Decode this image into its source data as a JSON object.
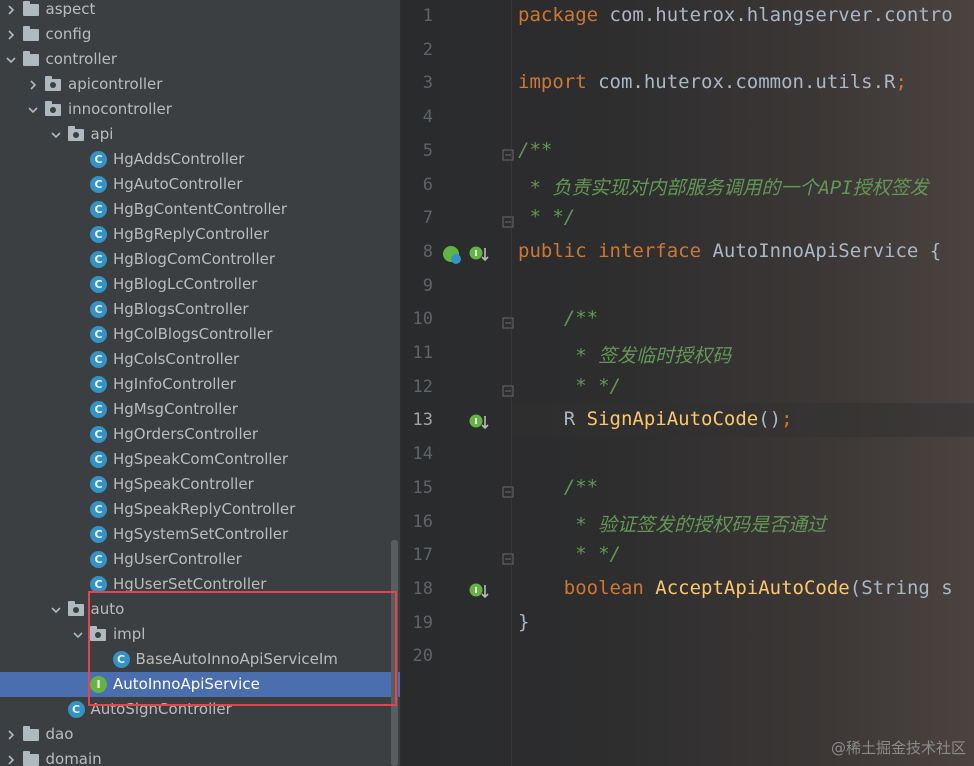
{
  "tree": {
    "items": [
      {
        "label": "aspect",
        "type": "folder",
        "depth": 3,
        "expanded": false,
        "selected": false
      },
      {
        "label": "config",
        "type": "folder",
        "depth": 3,
        "expanded": false,
        "selected": false
      },
      {
        "label": "controller",
        "type": "folder",
        "depth": 3,
        "expanded": true,
        "selected": false
      },
      {
        "label": "apicontroller",
        "type": "folder",
        "depth": 4,
        "expanded": false,
        "selected": false
      },
      {
        "label": "innocontroller",
        "type": "folder",
        "depth": 4,
        "expanded": true,
        "selected": false
      },
      {
        "label": "api",
        "type": "folder",
        "depth": 5,
        "expanded": true,
        "selected": false
      },
      {
        "label": "HgAddsController",
        "type": "class",
        "depth": 6,
        "selected": false
      },
      {
        "label": "HgAutoController",
        "type": "class",
        "depth": 6,
        "selected": false
      },
      {
        "label": "HgBgContentController",
        "type": "class",
        "depth": 6,
        "selected": false
      },
      {
        "label": "HgBgReplyController",
        "type": "class",
        "depth": 6,
        "selected": false
      },
      {
        "label": "HgBlogComController",
        "type": "class",
        "depth": 6,
        "selected": false
      },
      {
        "label": "HgBlogLcController",
        "type": "class",
        "depth": 6,
        "selected": false
      },
      {
        "label": "HgBlogsController",
        "type": "class",
        "depth": 6,
        "selected": false
      },
      {
        "label": "HgColBlogsController",
        "type": "class",
        "depth": 6,
        "selected": false
      },
      {
        "label": "HgColsController",
        "type": "class",
        "depth": 6,
        "selected": false
      },
      {
        "label": "HgInfoController",
        "type": "class",
        "depth": 6,
        "selected": false
      },
      {
        "label": "HgMsgController",
        "type": "class",
        "depth": 6,
        "selected": false
      },
      {
        "label": "HgOrdersController",
        "type": "class",
        "depth": 6,
        "selected": false
      },
      {
        "label": "HgSpeakComController",
        "type": "class",
        "depth": 6,
        "selected": false
      },
      {
        "label": "HgSpeakController",
        "type": "class",
        "depth": 6,
        "selected": false
      },
      {
        "label": "HgSpeakReplyController",
        "type": "class",
        "depth": 6,
        "selected": false
      },
      {
        "label": "HgSystemSetController",
        "type": "class",
        "depth": 6,
        "selected": false
      },
      {
        "label": "HgUserController",
        "type": "class",
        "depth": 6,
        "selected": false
      },
      {
        "label": "HgUserSetController",
        "type": "class",
        "depth": 6,
        "selected": false
      },
      {
        "label": "auto",
        "type": "folder",
        "depth": 5,
        "expanded": true,
        "selected": false
      },
      {
        "label": "impl",
        "type": "folder",
        "depth": 6,
        "expanded": true,
        "selected": false
      },
      {
        "label": "BaseAutoInnoApiServiceIm",
        "type": "class",
        "depth": 7,
        "selected": false
      },
      {
        "label": "AutoInnoApiService",
        "type": "interface",
        "depth": 6,
        "selected": true
      },
      {
        "label": "AutoSignController",
        "type": "class",
        "depth": 5,
        "selected": false
      },
      {
        "label": "dao",
        "type": "folder",
        "depth": 3,
        "expanded": false,
        "selected": false
      },
      {
        "label": "domain",
        "type": "folder",
        "depth": 3,
        "expanded": false,
        "selected": false
      }
    ]
  },
  "editor": {
    "current_line": 13,
    "lines": [
      {
        "n": "1",
        "tokens": [
          {
            "t": "package ",
            "c": "kw"
          },
          {
            "t": "com.huterox.hlangserver.contro",
            "c": "tx"
          }
        ]
      },
      {
        "n": "2",
        "tokens": []
      },
      {
        "n": "3",
        "tokens": [
          {
            "t": "import ",
            "c": "kw"
          },
          {
            "t": "com.huterox.common.utils.R",
            "c": "tx"
          },
          {
            "t": ";",
            "c": "kw"
          }
        ]
      },
      {
        "n": "4",
        "tokens": []
      },
      {
        "n": "5",
        "tokens": [
          {
            "t": "/**",
            "c": "cm"
          }
        ]
      },
      {
        "n": "6",
        "tokens": [
          {
            "t": " * 负责实现对内部服务调用的一个API授权签发",
            "c": "cm"
          }
        ]
      },
      {
        "n": "7",
        "tokens": [
          {
            "t": " * */",
            "c": "cm"
          }
        ]
      },
      {
        "n": "8",
        "tokens": [
          {
            "t": "public interface ",
            "c": "kw"
          },
          {
            "t": "AutoInnoApiService {",
            "c": "tx"
          }
        ]
      },
      {
        "n": "9",
        "tokens": []
      },
      {
        "n": "10",
        "tokens": [
          {
            "t": "    /**",
            "c": "cm"
          }
        ]
      },
      {
        "n": "11",
        "tokens": [
          {
            "t": "     * 签发临时授权码",
            "c": "cm"
          }
        ]
      },
      {
        "n": "12",
        "tokens": [
          {
            "t": "     * */",
            "c": "cm"
          }
        ]
      },
      {
        "n": "13",
        "tokens": [
          {
            "t": "    R ",
            "c": "tx"
          },
          {
            "t": "SignApiAutoCode",
            "c": "fn"
          },
          {
            "t": "()",
            "c": "tx"
          },
          {
            "t": ";",
            "c": "kw"
          }
        ]
      },
      {
        "n": "14",
        "tokens": []
      },
      {
        "n": "15",
        "tokens": [
          {
            "t": "    /**",
            "c": "cm"
          }
        ]
      },
      {
        "n": "16",
        "tokens": [
          {
            "t": "     * 验证签发的授权码是否通过",
            "c": "cm"
          }
        ]
      },
      {
        "n": "17",
        "tokens": [
          {
            "t": "     * */",
            "c": "cm"
          }
        ]
      },
      {
        "n": "18",
        "tokens": [
          {
            "t": "    ",
            "c": "tx"
          },
          {
            "t": "boolean ",
            "c": "kw"
          },
          {
            "t": "AcceptApiAutoCode",
            "c": "fn"
          },
          {
            "t": "(String s",
            "c": "tx"
          }
        ]
      },
      {
        "n": "19",
        "tokens": [
          {
            "t": "}",
            "c": "tx"
          }
        ]
      },
      {
        "n": "20",
        "tokens": []
      }
    ],
    "fold_lines": [
      5,
      7,
      10,
      12,
      15,
      17
    ],
    "impl_marks": [
      8,
      13,
      18
    ]
  },
  "icons": {
    "folder": "folder-icon",
    "class": "class-icon",
    "interface": "interface-icon"
  },
  "colors": {
    "keyword": "#cc7832",
    "comment": "#629755",
    "function": "#ffc66d",
    "text": "#a9b7c6",
    "selection": "#4b6eaf",
    "highlight_box": "#e2454f"
  },
  "watermark": "@稀土掘金技术社区"
}
